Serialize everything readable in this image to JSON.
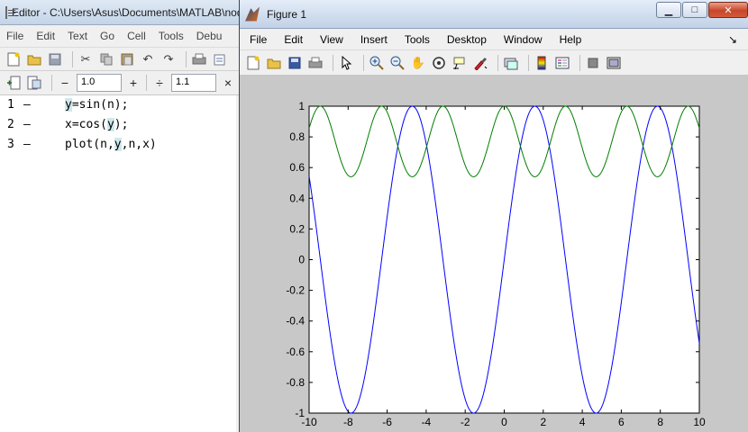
{
  "editor": {
    "title": "Editor - C:\\Users\\Asus\\Documents\\MATLAB\\nod",
    "menu": [
      "File",
      "Edit",
      "Text",
      "Go",
      "Cell",
      "Tools",
      "Debu"
    ],
    "cell_toolbar": {
      "minus": "−",
      "value1": "1.0",
      "plus": "+",
      "divide": "÷",
      "value2": "1.1",
      "times": "×"
    },
    "lines": [
      {
        "num": "1",
        "marker": "—",
        "pre": "",
        "hl": "y",
        "post": "=sin(n);"
      },
      {
        "num": "2",
        "marker": "—",
        "pre": "x=cos(",
        "hl": "y",
        "post": ");"
      },
      {
        "num": "3",
        "marker": "—",
        "pre": "plot(n,",
        "hl": "y",
        "post": ",n,x)"
      }
    ]
  },
  "figure": {
    "title": "Figure 1",
    "menu": [
      "File",
      "Edit",
      "View",
      "Insert",
      "Tools",
      "Desktop",
      "Window",
      "Help"
    ],
    "window_buttons": {
      "minimize": "▁",
      "maximize": "□",
      "close": "✕"
    }
  },
  "chart_data": {
    "type": "line",
    "title": "",
    "xlabel": "",
    "ylabel": "",
    "xlim": [
      -10,
      10
    ],
    "ylim": [
      -1,
      1
    ],
    "xticks": [
      -10,
      -8,
      -6,
      -4,
      -2,
      0,
      2,
      4,
      6,
      8,
      10
    ],
    "yticks": [
      -1,
      -0.8,
      -0.6,
      -0.4,
      -0.2,
      0,
      0.2,
      0.4,
      0.6,
      0.8,
      1
    ],
    "x_range": {
      "start": -10,
      "end": 10,
      "step": 0.1
    },
    "series": [
      {
        "expression": "y = sin(n)",
        "color": "#0000ff"
      },
      {
        "expression": "x = cos(sin(n))",
        "color": "#007f00"
      }
    ],
    "grid": false,
    "legend": "none"
  },
  "colors": {
    "plot_bg": "#c8c8c8",
    "axes_bg": "#ffffff",
    "highlight": "#cfe8ec"
  }
}
